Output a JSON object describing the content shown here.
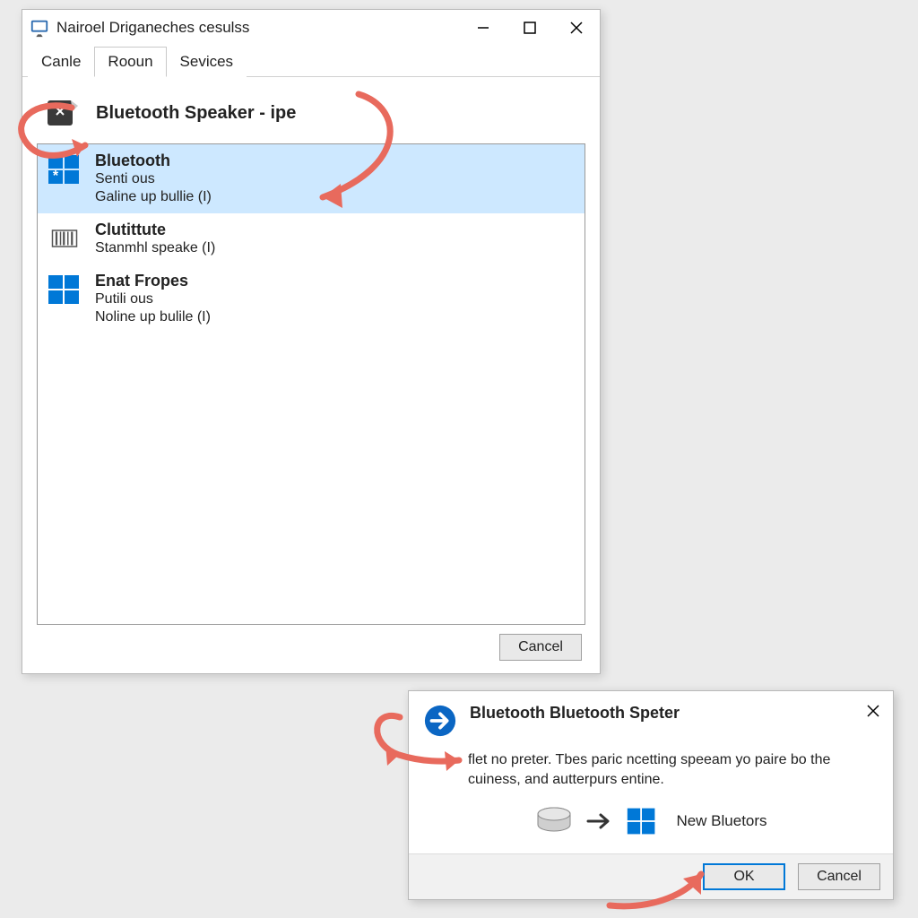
{
  "window": {
    "title": "Nairoel Driganeches cesulss",
    "tabs": [
      {
        "label": "Canle"
      },
      {
        "label": "Rooun"
      },
      {
        "label": "Sevices"
      }
    ],
    "active_tab": 1,
    "device_name": "Bluetooth Speaker - ipe",
    "items": [
      {
        "name": "Bluetooth",
        "line1": "Senti ous",
        "line2": "Galine up bullie (I)",
        "icon": "windows",
        "selected": true
      },
      {
        "name": "Clutittute",
        "line1": "Stanmhl speake (I)",
        "line2": "",
        "icon": "barcode",
        "selected": false
      },
      {
        "name": "Enat Fropes",
        "line1": "Putili ous",
        "line2": "Noline up bulile (I)",
        "icon": "windows",
        "selected": false
      }
    ],
    "cancel_label": "Cancel"
  },
  "dialog": {
    "title": "Bluetooth Bluetooth Speter",
    "body": "flet no preter. Tbes paric ncetting speeam yo paire bo the cuiness, and autterpurs entine.",
    "target_label": "New Bluetors",
    "ok_label": "OK",
    "cancel_label": "Cancel"
  }
}
